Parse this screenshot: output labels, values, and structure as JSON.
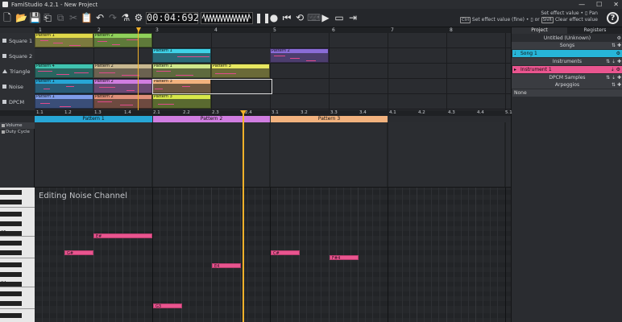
{
  "window": {
    "title": "FamiStudio 4.2.1 - New Project",
    "minimize": "—",
    "maximize": "☐",
    "close": "✕"
  },
  "toolbar": {
    "timecode": "00:04:692"
  },
  "hints": {
    "line1_key": "",
    "line1_text": "Set effect value • ▯ Pan",
    "line2_key1": "Ctrl",
    "line2_text1": "Set effect value (fine) • ▯ or",
    "line2_key2": "Shift",
    "line2_text2": "Clear effect value"
  },
  "sequencer": {
    "bars": [
      "1",
      "2",
      "3",
      "4",
      "5",
      "6",
      "7",
      "8"
    ],
    "channels": [
      {
        "name": "Square 1"
      },
      {
        "name": "Square 2"
      },
      {
        "name": "Triangle"
      },
      {
        "name": "Noise"
      },
      {
        "name": "DPCM"
      }
    ],
    "patterns": {
      "sq1_p1": "Pattern 1",
      "sq1_p2": "Pattern 2",
      "sq2_p1": "Pattern 1",
      "sq2_p2": "Pattern 2",
      "tri_p4": "Pattern 4",
      "tri_p2": "Pattern 2",
      "tri_p1": "Pattern 1",
      "tri_p3": "Pattern 3",
      "noi_p1": "Pattern 1",
      "noi_p2": "Pattern 2",
      "noi_p3": "Pattern 3",
      "dpcm_p1": "Pattern 1",
      "dpcm_p2": "Pattern 2",
      "dpcm_p3": "Pattern 3"
    }
  },
  "project_panel": {
    "tabs": [
      "Project",
      "Registers"
    ],
    "project_name": "Untitled (Unknown)",
    "songs_header": "Songs",
    "song": "Song 1",
    "instruments_header": "Instruments",
    "instrument": "Instrument 1",
    "dpcm_header": "DPCM Samples",
    "arpeggios_header": "Arpeggios",
    "arpeggio_none": "None"
  },
  "piano_roll": {
    "ticks": [
      "1.1",
      "1.2",
      "1.3",
      "1.4",
      "2.1",
      "2.2",
      "2.3",
      "2.4",
      "3.1",
      "3.2",
      "3.3",
      "3.4",
      "4.1",
      "4.2",
      "4.3",
      "4.4",
      "5.1"
    ],
    "patterns": [
      "Pattern 1",
      "Pattern 2",
      "Pattern 3"
    ],
    "effects": [
      "Volume",
      "Duty Cycle"
    ],
    "editing_label": "Editing Noise Channel",
    "octave_labels": [
      "C5",
      "C4"
    ],
    "notes": [
      "E#",
      "G#",
      "E4",
      "C#",
      "F#4",
      "G3"
    ]
  },
  "colors": {
    "song": "#27b5d8",
    "instrument": "#e9558f",
    "pattern1": "#27a6d6",
    "pattern2": "#d07de0",
    "pattern3": "#f2b27e",
    "playhead": "#f1b12a"
  }
}
